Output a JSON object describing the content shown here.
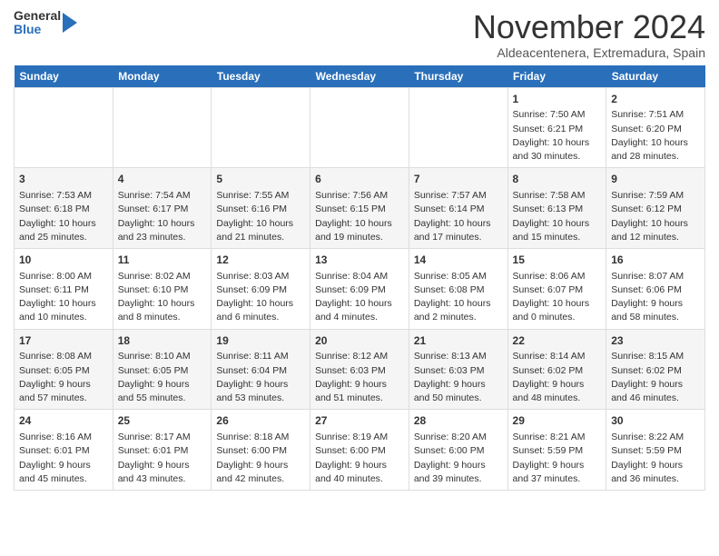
{
  "header": {
    "logo_general": "General",
    "logo_blue": "Blue",
    "title": "November 2024",
    "subtitle": "Aldeacentenera, Extremadura, Spain"
  },
  "days_of_week": [
    "Sunday",
    "Monday",
    "Tuesday",
    "Wednesday",
    "Thursday",
    "Friday",
    "Saturday"
  ],
  "weeks": [
    [
      {
        "day": "",
        "info": ""
      },
      {
        "day": "",
        "info": ""
      },
      {
        "day": "",
        "info": ""
      },
      {
        "day": "",
        "info": ""
      },
      {
        "day": "",
        "info": ""
      },
      {
        "day": "1",
        "info": "Sunrise: 7:50 AM\nSunset: 6:21 PM\nDaylight: 10 hours and 30 minutes."
      },
      {
        "day": "2",
        "info": "Sunrise: 7:51 AM\nSunset: 6:20 PM\nDaylight: 10 hours and 28 minutes."
      }
    ],
    [
      {
        "day": "3",
        "info": "Sunrise: 7:53 AM\nSunset: 6:18 PM\nDaylight: 10 hours and 25 minutes."
      },
      {
        "day": "4",
        "info": "Sunrise: 7:54 AM\nSunset: 6:17 PM\nDaylight: 10 hours and 23 minutes."
      },
      {
        "day": "5",
        "info": "Sunrise: 7:55 AM\nSunset: 6:16 PM\nDaylight: 10 hours and 21 minutes."
      },
      {
        "day": "6",
        "info": "Sunrise: 7:56 AM\nSunset: 6:15 PM\nDaylight: 10 hours and 19 minutes."
      },
      {
        "day": "7",
        "info": "Sunrise: 7:57 AM\nSunset: 6:14 PM\nDaylight: 10 hours and 17 minutes."
      },
      {
        "day": "8",
        "info": "Sunrise: 7:58 AM\nSunset: 6:13 PM\nDaylight: 10 hours and 15 minutes."
      },
      {
        "day": "9",
        "info": "Sunrise: 7:59 AM\nSunset: 6:12 PM\nDaylight: 10 hours and 12 minutes."
      }
    ],
    [
      {
        "day": "10",
        "info": "Sunrise: 8:00 AM\nSunset: 6:11 PM\nDaylight: 10 hours and 10 minutes."
      },
      {
        "day": "11",
        "info": "Sunrise: 8:02 AM\nSunset: 6:10 PM\nDaylight: 10 hours and 8 minutes."
      },
      {
        "day": "12",
        "info": "Sunrise: 8:03 AM\nSunset: 6:09 PM\nDaylight: 10 hours and 6 minutes."
      },
      {
        "day": "13",
        "info": "Sunrise: 8:04 AM\nSunset: 6:09 PM\nDaylight: 10 hours and 4 minutes."
      },
      {
        "day": "14",
        "info": "Sunrise: 8:05 AM\nSunset: 6:08 PM\nDaylight: 10 hours and 2 minutes."
      },
      {
        "day": "15",
        "info": "Sunrise: 8:06 AM\nSunset: 6:07 PM\nDaylight: 10 hours and 0 minutes."
      },
      {
        "day": "16",
        "info": "Sunrise: 8:07 AM\nSunset: 6:06 PM\nDaylight: 9 hours and 58 minutes."
      }
    ],
    [
      {
        "day": "17",
        "info": "Sunrise: 8:08 AM\nSunset: 6:05 PM\nDaylight: 9 hours and 57 minutes."
      },
      {
        "day": "18",
        "info": "Sunrise: 8:10 AM\nSunset: 6:05 PM\nDaylight: 9 hours and 55 minutes."
      },
      {
        "day": "19",
        "info": "Sunrise: 8:11 AM\nSunset: 6:04 PM\nDaylight: 9 hours and 53 minutes."
      },
      {
        "day": "20",
        "info": "Sunrise: 8:12 AM\nSunset: 6:03 PM\nDaylight: 9 hours and 51 minutes."
      },
      {
        "day": "21",
        "info": "Sunrise: 8:13 AM\nSunset: 6:03 PM\nDaylight: 9 hours and 50 minutes."
      },
      {
        "day": "22",
        "info": "Sunrise: 8:14 AM\nSunset: 6:02 PM\nDaylight: 9 hours and 48 minutes."
      },
      {
        "day": "23",
        "info": "Sunrise: 8:15 AM\nSunset: 6:02 PM\nDaylight: 9 hours and 46 minutes."
      }
    ],
    [
      {
        "day": "24",
        "info": "Sunrise: 8:16 AM\nSunset: 6:01 PM\nDaylight: 9 hours and 45 minutes."
      },
      {
        "day": "25",
        "info": "Sunrise: 8:17 AM\nSunset: 6:01 PM\nDaylight: 9 hours and 43 minutes."
      },
      {
        "day": "26",
        "info": "Sunrise: 8:18 AM\nSunset: 6:00 PM\nDaylight: 9 hours and 42 minutes."
      },
      {
        "day": "27",
        "info": "Sunrise: 8:19 AM\nSunset: 6:00 PM\nDaylight: 9 hours and 40 minutes."
      },
      {
        "day": "28",
        "info": "Sunrise: 8:20 AM\nSunset: 6:00 PM\nDaylight: 9 hours and 39 minutes."
      },
      {
        "day": "29",
        "info": "Sunrise: 8:21 AM\nSunset: 5:59 PM\nDaylight: 9 hours and 37 minutes."
      },
      {
        "day": "30",
        "info": "Sunrise: 8:22 AM\nSunset: 5:59 PM\nDaylight: 9 hours and 36 minutes."
      }
    ]
  ]
}
